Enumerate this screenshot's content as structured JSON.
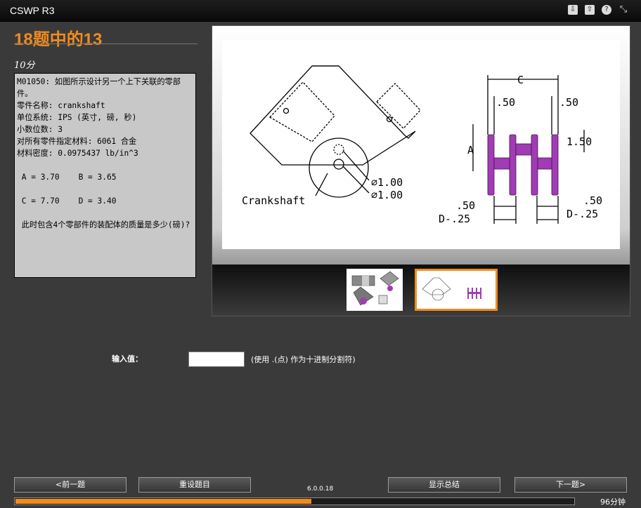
{
  "window": {
    "title": "CSWP R3"
  },
  "toolbar_icons": [
    "save-icon",
    "upload-icon",
    "help-icon",
    "expand-icon"
  ],
  "header": {
    "progress_title": "18题中的13",
    "points": "10分"
  },
  "question": {
    "text": "M01050: 如图所示设计另一个上下关联的零部件。\n零件名称: crankshaft\n单位系统: IPS (英寸, 磅, 秒)\n小数位数: 3\n对所有零件指定材料: 6061 合金\n材料密度: 0.0975437 lb/in^3\n\n A = 3.70    B = 3.65\n\n C = 7.70    D = 3.40\n\n 此时包含4个零部件的装配体的质量是多少(磅)?"
  },
  "drawing": {
    "crankshaft_label": "Crankshaft",
    "diameter_1": "∅1.00",
    "diameter_2": "∅1.00",
    "dim_c": "C",
    "dim_top_left": ".50",
    "dim_top_right": ".50",
    "dim_a": "A",
    "dim_150": "1.50",
    "dim_bottom_left": ".50",
    "dim_bottom_right": ".50",
    "dim_d_left": "D-.25",
    "dim_d_right": "D-.25"
  },
  "thumbnails": {
    "selected_index": 1
  },
  "answer": {
    "label": "输入值：",
    "value": "",
    "hint": "(使用 .(点) 作为十进制分割符)"
  },
  "buttons": {
    "prev": "<前一题",
    "reset": "重设题目",
    "summary": "显示总结",
    "next": "下一题>"
  },
  "footer": {
    "version": "6.0.0.18",
    "time_left": "96分钟",
    "progress_fraction": 0.53
  },
  "colors": {
    "accent": "#f08c1e",
    "part_purple": "#a03cb4"
  }
}
